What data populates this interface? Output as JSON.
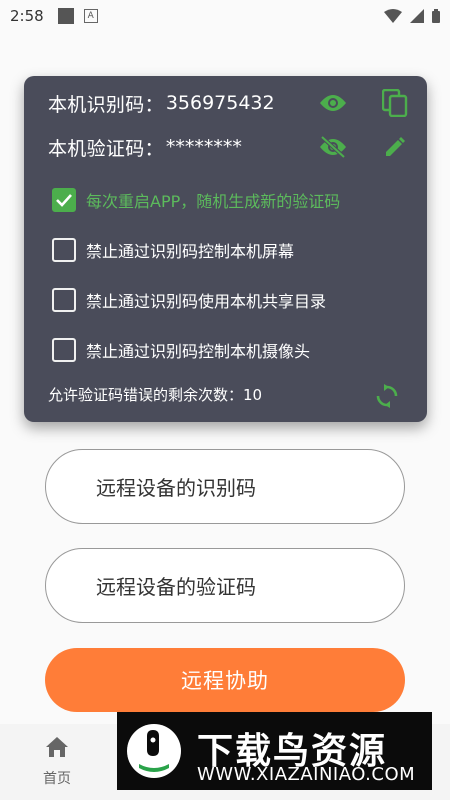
{
  "status_bar": {
    "time": "2:58"
  },
  "card": {
    "id_label": "本机识别码：",
    "id_value": "356975432",
    "verify_label": "本机验证码：",
    "verify_value": "********",
    "options": [
      {
        "label": "每次重启APP，随机生成新的验证码",
        "checked": true
      },
      {
        "label": "禁止通过识别码控制本机屏幕",
        "checked": false
      },
      {
        "label": "禁止通过识别码使用本机共享目录",
        "checked": false
      },
      {
        "label": "禁止通过识别码控制本机摄像头",
        "checked": false
      }
    ],
    "retry_label": "允许验证码错误的剩余次数：",
    "retry_count": "10"
  },
  "remote_id_button": "远程设备的识别码",
  "remote_verify_button": "远程设备的验证码",
  "remote_assist_button": "远程协助",
  "nav": {
    "home_label": "首页"
  },
  "watermark": {
    "name": "下载鸟资源",
    "url": "WWW.XIAZAINIAO.COM"
  },
  "colors": {
    "accent_green": "#4cae4c",
    "primary_orange": "#ff7d38",
    "card_bg": "#4a4c5a"
  }
}
